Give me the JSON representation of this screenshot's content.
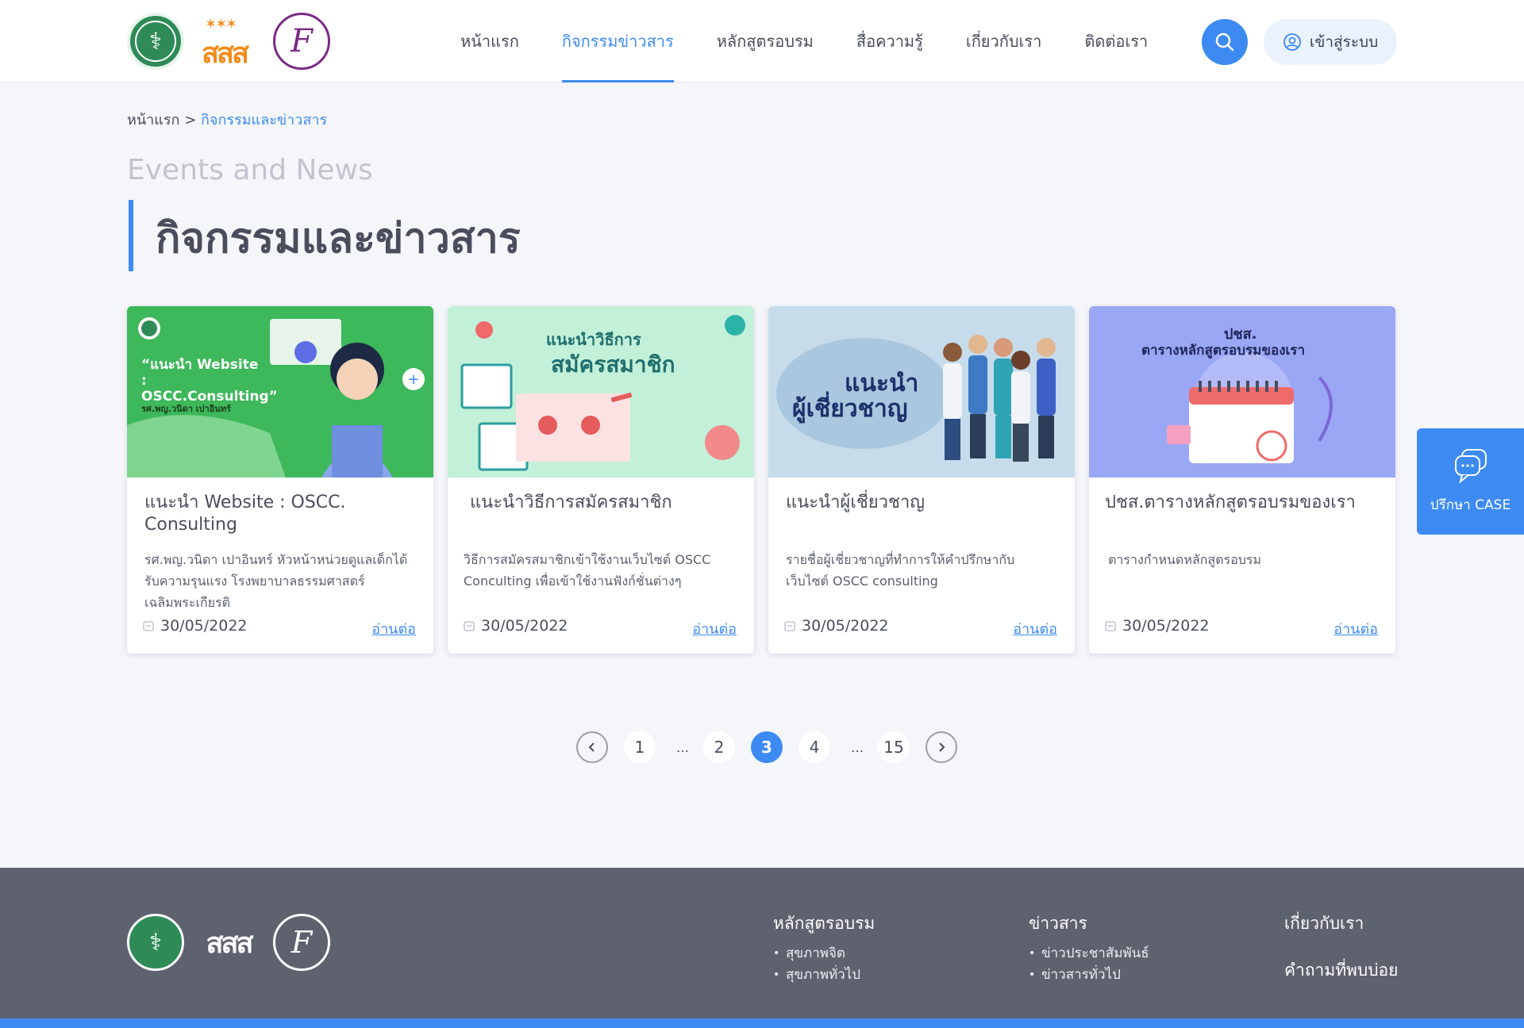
{
  "header": {
    "nav": [
      {
        "label": "หน้าแรก",
        "active": false
      },
      {
        "label": "กิจกรรมข่าวสาร",
        "active": true
      },
      {
        "label": "หลักสูตรอบรม",
        "active": false
      },
      {
        "label": "สื่อความรู้",
        "active": false
      },
      {
        "label": "เกี่ยวกับเรา",
        "active": false
      },
      {
        "label": "ติดต่อเรา",
        "active": false
      }
    ],
    "login_label": "เข้าสู่ระบบ",
    "logo_sss_text": "สสส"
  },
  "breadcrumb": {
    "home": "หน้าแรก",
    "separator": ">",
    "current": "กิจกรรมและข่าวสาร"
  },
  "page": {
    "subtitle_en": "Events and News",
    "title": "กิจกรรมและข่าวสาร"
  },
  "cards": [
    {
      "image_title": "“แนะนำ Website : OSCC.Consulting”",
      "image_sub": "รศ.พญ.วนิดา เปาอินทร์",
      "title": "แนะนำ Website : OSCC. Consulting",
      "description": "รศ.พญ.วนิดา เปาอินทร์ หัวหน้าหน่วยดูแลเด็กได้รับความรุนแรง โรงพยาบาลธรรมศาสตร์เฉลิมพระเกียรติ",
      "date": "30/05/2022",
      "read_more": "อ่านต่อ"
    },
    {
      "image_title": "แนะนำวิธีการ",
      "image_sub": "สมัครสมาชิก",
      "title": "แนะนำวิธีการสมัครสมาชิก",
      "description": "วิธีการสมัครสมาชิกเข้าใช้งานเว็บไซต์ OSCC Conculting เพื่อเข้าใช้งานฟังก์ชั่นต่างๆ",
      "date": "30/05/2022",
      "read_more": "อ่านต่อ"
    },
    {
      "image_title": "แนะนำ",
      "image_sub": "ผู้เชี่ยวชาญ",
      "title": "แนะนำผู้เชี่ยวชาญ",
      "description": "รายชื่อผู้เชี่ยวชาญที่ทำการให้คำปรึกษากับเว็บไซต์ OSCC consulting",
      "date": "30/05/2022",
      "read_more": "อ่านต่อ"
    },
    {
      "image_title": "ปชส.",
      "image_sub": "ตารางหลักสูตรอบรมของเรา",
      "title": "ปชส.ตารางหลักสูตรอบรมของเรา",
      "description": "ตารางกำหนดหลักสูตรอบรม",
      "date": "30/05/2022",
      "read_more": "อ่านต่อ"
    }
  ],
  "pagination": {
    "pages": [
      "1",
      "…",
      "2",
      "3",
      "4",
      "…",
      "15"
    ],
    "current": "3"
  },
  "consult": {
    "label": "ปรึกษา CASE"
  },
  "footer": {
    "col1": {
      "title": "หลักสูตรอบรม",
      "items": [
        "สุขภาพจิต",
        "สุขภาพทั่วไป"
      ]
    },
    "col2": {
      "title": "ข่าวสาร",
      "items": [
        "ข่าวประชาสัมพันธ์",
        "ข่าวสารทั่วไป"
      ]
    },
    "col3": {
      "title": "เกี่ยวกับเรา",
      "title2": "คำถามที่พบบ่อย"
    }
  },
  "colors": {
    "accent": "#3d8bf2",
    "footer_bg": "#5e616e",
    "text": "#4a4d5c"
  }
}
